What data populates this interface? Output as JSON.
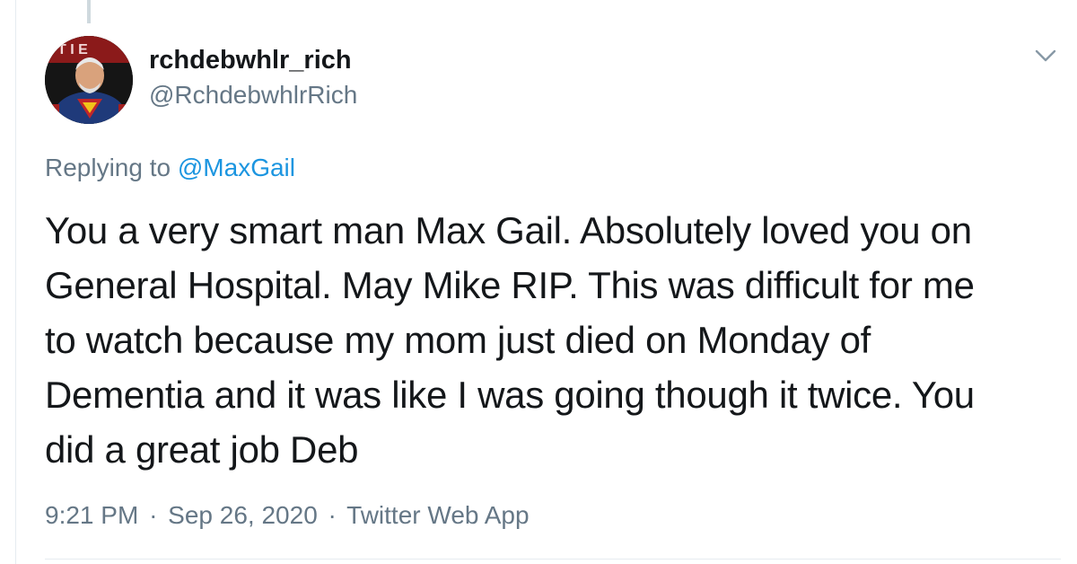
{
  "tweet": {
    "display_name": "rchdebwhlr_rich",
    "handle": "@RchdebwhlrRich",
    "replying_prefix": "Replying to",
    "replying_to": "@MaxGail",
    "text_lines": [
      "You a very smart man Max Gail. Absolutely loved you on",
      "General Hospital.  May Mike RIP.  This was difficult for me",
      "to watch because my mom just died on Monday of",
      "Dementia and it was like I was going though it twice. You",
      "did a great job Deb"
    ],
    "time": "9:21 PM",
    "date": "Sep 26, 2020",
    "source": "Twitter Web App",
    "separator": "·"
  },
  "icons": {
    "menu": "chevron-down-icon",
    "avatar": "superhero-avatar"
  },
  "colors": {
    "text": "#14171a",
    "secondary": "#657786",
    "link": "#1b95e0",
    "border": "#e6ecf0"
  }
}
